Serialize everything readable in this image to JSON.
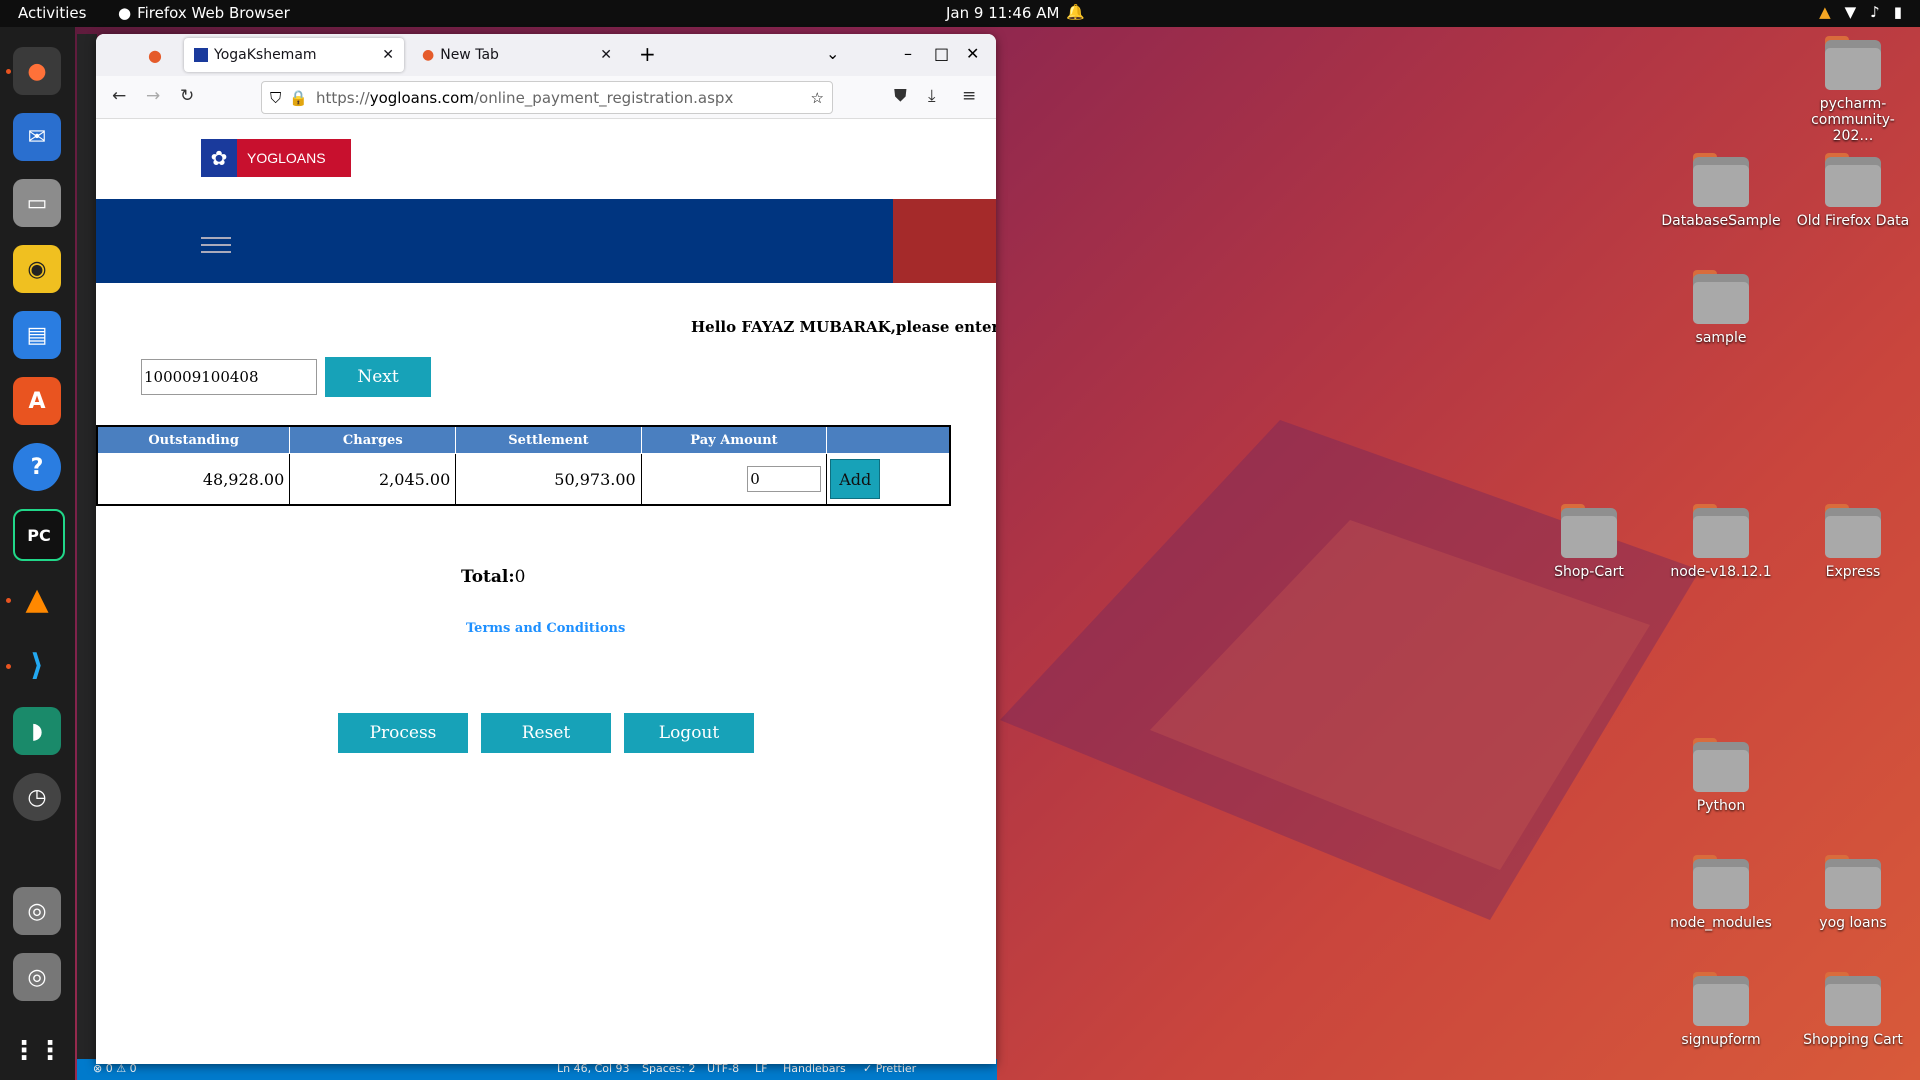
{
  "topbar": {
    "activities": "Activities",
    "app_name": "Firefox Web Browser",
    "datetime": "Jan 9  11:46 AM"
  },
  "desktop_icons": [
    {
      "label": "pycharm-\ncommunity-202…"
    },
    {
      "label": "DatabaseSample"
    },
    {
      "label": "Old Firefox Data"
    },
    {
      "label": "sample"
    },
    {
      "label": "Shop-Cart"
    },
    {
      "label": "node-v18.12.1"
    },
    {
      "label": "Express"
    },
    {
      "label": "Python"
    },
    {
      "label": "node_modules"
    },
    {
      "label": "yog loans"
    },
    {
      "label": "signupform"
    },
    {
      "label": "Shopping Cart"
    }
  ],
  "browser": {
    "tabs": [
      {
        "title": "YogaKshemam"
      },
      {
        "title": "New Tab"
      }
    ],
    "url_prefix": "https://",
    "url_domain": "yogloans.com",
    "url_path": "/online_payment_registration.aspx"
  },
  "page": {
    "logo_text": "YOGLOANS",
    "greeting": "Hello FAYAZ MUBARAK,please enter de",
    "loan_number": "100009100408",
    "next_label": "Next",
    "table": {
      "headers": [
        "Outstanding",
        "Charges",
        "Settlement",
        "Pay Amount",
        ""
      ],
      "row": {
        "outstanding": "48,928.00",
        "charges": "2,045.00",
        "settlement": "50,973.00",
        "pay_amount": "0"
      },
      "add_label": "Add"
    },
    "total_label": "Total:",
    "total_value": "0",
    "terms": "Terms and Conditions",
    "process_label": "Process",
    "reset_label": "Reset",
    "logout_label": "Logout"
  },
  "vscode_status": {
    "problems": "⊗ 0 ⚠ 0",
    "position": "Ln 46, Col 93",
    "spaces": "Spaces: 2",
    "encoding": "UTF-8",
    "eol": "LF",
    "language": "Handlebars",
    "prettier": "✓ Prettier"
  },
  "colors": {
    "nav_blue": "#003580",
    "accent_red": "#a52a2a",
    "button_teal": "#17a2b8",
    "table_header": "#4a7fc0"
  }
}
